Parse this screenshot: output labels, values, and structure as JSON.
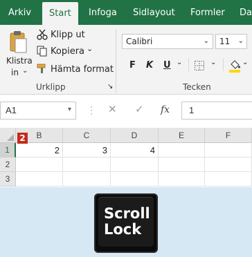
{
  "tabs": [
    "Arkiv",
    "Start",
    "Infoga",
    "Sidlayout",
    "Formler",
    "Da"
  ],
  "clipboard": {
    "paste_label_line1": "Klistra",
    "paste_label_line2": "in",
    "cut_label": "Klipp ut",
    "copy_label": "Kopiera",
    "format_painter_label": "Hämta format",
    "group_label": "Urklipp"
  },
  "font": {
    "name": "Calibri",
    "size": "11",
    "bold": "F",
    "italic": "K",
    "underline": "U",
    "group_label": "Tecken"
  },
  "formula_bar": {
    "name_box": "A1",
    "cancel": "✕",
    "enter": "✓",
    "fx": "fx",
    "value": "1"
  },
  "grid": {
    "columns": [
      "B",
      "C",
      "D",
      "E",
      "F"
    ],
    "rows": [
      "1",
      "2",
      "3"
    ],
    "row1_values": [
      "2",
      "3",
      "4",
      "",
      ""
    ],
    "badge": "2"
  },
  "key": {
    "line1": "Scroll",
    "line2": "Lock"
  },
  "colors": {
    "accent": "#217346",
    "badge": "#c42b1c",
    "background_bottom": "#d5e8f4"
  }
}
